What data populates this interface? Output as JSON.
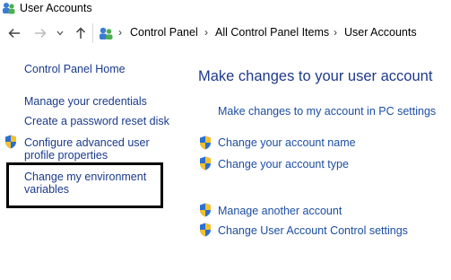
{
  "window": {
    "title": "User Accounts"
  },
  "address": {
    "crumbs": [
      "Control Panel",
      "All Control Panel Items",
      "User Accounts"
    ]
  },
  "sidebar": {
    "home": "Control Panel Home",
    "links": [
      {
        "label": "Manage your credentials"
      },
      {
        "label": "Create a password reset disk"
      },
      {
        "label_line1": "Configure advanced user",
        "label_line2": "profile properties"
      },
      {
        "label_line1": "Change my environment",
        "label_line2": "variables"
      }
    ]
  },
  "main": {
    "heading": "Make changes to your user account",
    "pc_settings_link": "Make changes to my account in PC settings",
    "tasks": [
      {
        "label": "Change your account name"
      },
      {
        "label": "Change your account type"
      },
      {
        "label": "Manage another account"
      },
      {
        "label": "Change User Account Control settings"
      }
    ]
  },
  "colors": {
    "link": "#1c4ea3",
    "heading": "#1e3a8c",
    "highlight_border": "#000000"
  }
}
